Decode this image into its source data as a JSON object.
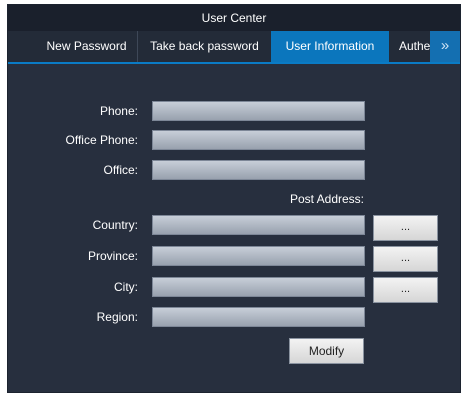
{
  "window": {
    "title": "User Center"
  },
  "tabs": [
    {
      "label": "New Password"
    },
    {
      "label": "Take back password"
    },
    {
      "label": "User Information",
      "active": true
    },
    {
      "label": "Authe"
    }
  ],
  "more_icon": "»",
  "form": {
    "phone_label": "Phone:",
    "office_phone_label": "Office Phone:",
    "office_label": "Office:",
    "post_address_label": "Post Address:",
    "country_label": "Country:",
    "province_label": "Province:",
    "city_label": "City:",
    "region_label": "Region:",
    "phone_value": "",
    "office_phone_value": "",
    "office_value": "",
    "country_value": "",
    "province_value": "",
    "city_value": "",
    "region_value": "",
    "browse_label": "...",
    "modify_label": "Modify"
  },
  "colors": {
    "accent": "#0b76bd",
    "background": "#272f3e"
  }
}
